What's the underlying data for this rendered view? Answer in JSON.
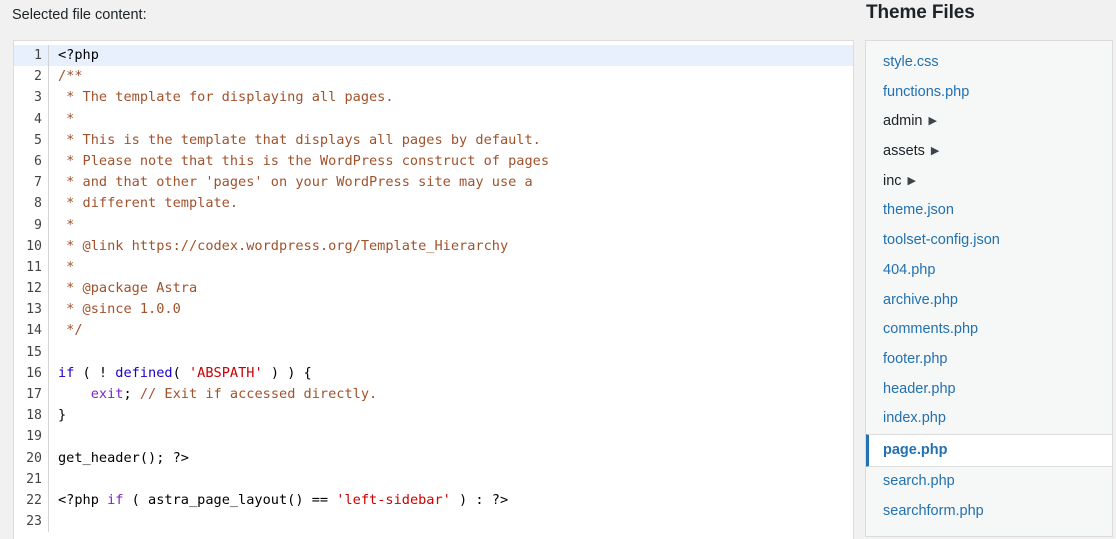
{
  "header": {
    "selected_file_label": "Selected file content:",
    "theme_files_title": "Theme Files"
  },
  "editor": {
    "language": "php",
    "active_line": 1,
    "colors": {
      "comment": "#a0522d",
      "keyword": "#1a01cc",
      "keyword_alt": "#7d26cd",
      "string": "#cc0000",
      "text": "#000000",
      "active_line_bg": "#e8f0fe",
      "gutter_text": "#444444",
      "background": "#ffffff"
    },
    "lines": [
      {
        "n": "1",
        "tokens": [
          {
            "c": "plain",
            "t": "<?php"
          }
        ]
      },
      {
        "n": "2",
        "tokens": [
          {
            "c": "com",
            "t": "/**"
          }
        ]
      },
      {
        "n": "3",
        "tokens": [
          {
            "c": "com",
            "t": " * The template for displaying all pages."
          }
        ]
      },
      {
        "n": "4",
        "tokens": [
          {
            "c": "com",
            "t": " *"
          }
        ]
      },
      {
        "n": "5",
        "tokens": [
          {
            "c": "com",
            "t": " * This is the template that displays all pages by default."
          }
        ]
      },
      {
        "n": "6",
        "tokens": [
          {
            "c": "com",
            "t": " * Please note that this is the WordPress construct of pages"
          }
        ]
      },
      {
        "n": "7",
        "tokens": [
          {
            "c": "com",
            "t": " * and that other 'pages' on your WordPress site may use a"
          }
        ]
      },
      {
        "n": "8",
        "tokens": [
          {
            "c": "com",
            "t": " * different template."
          }
        ]
      },
      {
        "n": "9",
        "tokens": [
          {
            "c": "com",
            "t": " *"
          }
        ]
      },
      {
        "n": "10",
        "tokens": [
          {
            "c": "com",
            "t": " * @link https://codex.wordpress.org/Template_Hierarchy"
          }
        ]
      },
      {
        "n": "11",
        "tokens": [
          {
            "c": "com",
            "t": " *"
          }
        ]
      },
      {
        "n": "12",
        "tokens": [
          {
            "c": "com",
            "t": " * @package Astra"
          }
        ]
      },
      {
        "n": "13",
        "tokens": [
          {
            "c": "com",
            "t": " * @since 1.0.0"
          }
        ]
      },
      {
        "n": "14",
        "tokens": [
          {
            "c": "com",
            "t": " */"
          }
        ]
      },
      {
        "n": "15",
        "tokens": [
          {
            "c": "plain",
            "t": ""
          }
        ]
      },
      {
        "n": "16",
        "tokens": [
          {
            "c": "kw",
            "t": "if"
          },
          {
            "c": "plain",
            "t": " ( ! "
          },
          {
            "c": "kw",
            "t": "defined"
          },
          {
            "c": "plain",
            "t": "( "
          },
          {
            "c": "str",
            "t": "'ABSPATH'"
          },
          {
            "c": "plain",
            "t": " ) ) {"
          }
        ]
      },
      {
        "n": "17",
        "tokens": [
          {
            "c": "plain",
            "t": "    "
          },
          {
            "c": "kw2",
            "t": "exit"
          },
          {
            "c": "plain",
            "t": "; "
          },
          {
            "c": "com",
            "t": "// Exit if accessed directly."
          }
        ]
      },
      {
        "n": "18",
        "tokens": [
          {
            "c": "plain",
            "t": "}"
          }
        ]
      },
      {
        "n": "19",
        "tokens": [
          {
            "c": "plain",
            "t": ""
          }
        ]
      },
      {
        "n": "20",
        "tokens": [
          {
            "c": "plain",
            "t": "get_header(); ?>"
          }
        ]
      },
      {
        "n": "21",
        "tokens": [
          {
            "c": "plain",
            "t": ""
          }
        ]
      },
      {
        "n": "22",
        "tokens": [
          {
            "c": "plain",
            "t": "<?php "
          },
          {
            "c": "kw2",
            "t": "if"
          },
          {
            "c": "plain",
            "t": " ( astra_page_layout() == "
          },
          {
            "c": "str",
            "t": "'left-sidebar'"
          },
          {
            "c": "plain",
            "t": " ) : ?>"
          }
        ]
      },
      {
        "n": "23",
        "tokens": [
          {
            "c": "plain",
            "t": ""
          }
        ]
      }
    ]
  },
  "theme_files": {
    "selected": "page.php",
    "selected_accent": "#2271b1",
    "link_color": "#2271b1",
    "folder_arrow_glyph": "▶",
    "items": [
      {
        "label": "style.css",
        "type": "file"
      },
      {
        "label": "functions.php",
        "type": "file"
      },
      {
        "label": "admin",
        "type": "folder"
      },
      {
        "label": "assets",
        "type": "folder"
      },
      {
        "label": "inc",
        "type": "folder"
      },
      {
        "label": "theme.json",
        "type": "file"
      },
      {
        "label": "toolset-config.json",
        "type": "file"
      },
      {
        "label": "404.php",
        "type": "file"
      },
      {
        "label": "archive.php",
        "type": "file"
      },
      {
        "label": "comments.php",
        "type": "file"
      },
      {
        "label": "footer.php",
        "type": "file"
      },
      {
        "label": "header.php",
        "type": "file"
      },
      {
        "label": "index.php",
        "type": "file"
      },
      {
        "label": "page.php",
        "type": "file",
        "selected": true
      },
      {
        "label": "search.php",
        "type": "file"
      },
      {
        "label": "searchform.php",
        "type": "file"
      }
    ]
  }
}
